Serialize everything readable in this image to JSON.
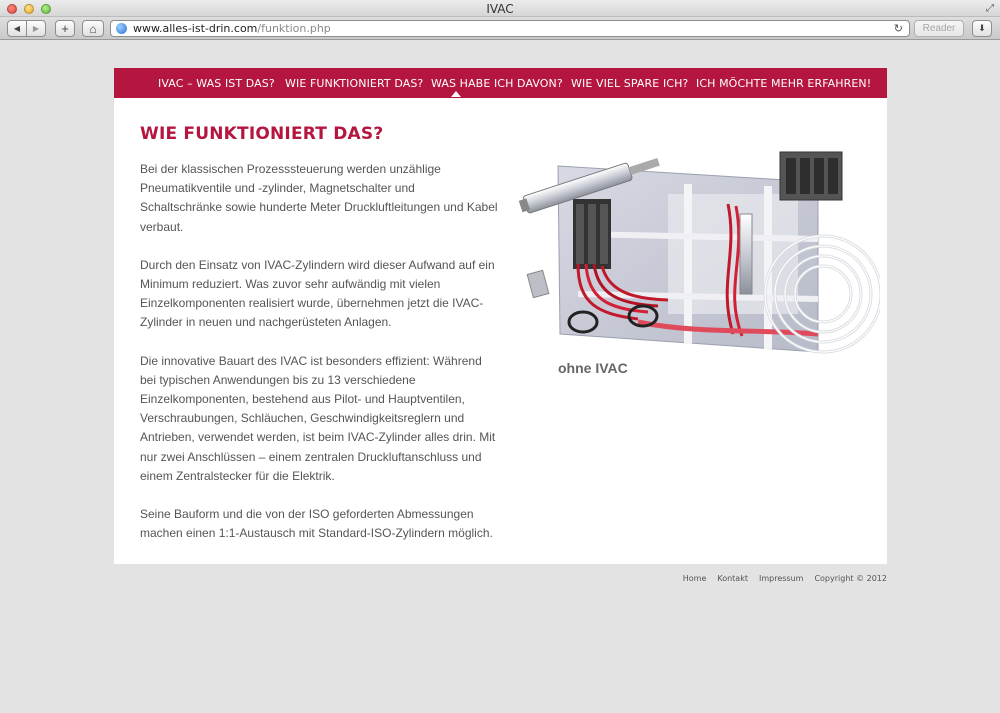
{
  "window": {
    "title": "IVAC"
  },
  "toolbar": {
    "back_icon": "◀",
    "forward_icon": "▶",
    "add_icon": "+",
    "home_icon": "⌂",
    "url_host": "www.alles-ist-drin.com",
    "url_path": "/funktion.php",
    "reload_icon": "↻",
    "reader_label": "Reader",
    "downloads_icon": "⬇"
  },
  "nav": {
    "items": [
      {
        "label": "IVAC – WAS IST DAS?"
      },
      {
        "label": "WIE FUNKTIONIERT DAS?"
      },
      {
        "label": "WAS HABE ICH DAVON?"
      },
      {
        "label": "WIE VIEL SPARE ICH?"
      },
      {
        "label": "ICH MÖCHTE MEHR ERFAHREN!"
      }
    ],
    "active_index": 1,
    "color": "#b5163f"
  },
  "main": {
    "title": "WIE FUNKTIONIERT DAS?",
    "paragraphs": [
      "Bei der klassischen Prozesssteuerung werden unzählige Pneumatikventile und -zylinder, Magnetschalter und Schaltschränke sowie hunderte Meter Druckluftleitungen und Kabel verbaut.",
      "Durch den Einsatz von IVAC-Zylindern wird dieser Aufwand auf ein Minimum reduziert. Was zuvor sehr aufwändig mit vielen Einzelkomponenten realisiert wurde, übernehmen jetzt die IVAC-Zylinder in neuen und nachgerüsteten Anlagen.",
      "Die innovative Bauart des IVAC ist besonders effizient: Während bei typischen Anwendungen bis zu 13 verschiedene Einzelkomponenten, bestehend aus Pilot- und Hauptventilen, Verschraubungen, Schläuchen, Geschwindigkeitsreglern und Antrieben, verwendet werden, ist beim IVAC-Zylinder alles drin. Mit nur zwei Anschlüssen – einem zentralen Druckluftanschluss und einem Zentralstecker für die Elektrik.",
      "Seine Bauform und die von der ISO geforderten Abmessungen machen einen 1:1-Austausch mit Standard-ISO-Zylindern möglich."
    ],
    "figure_caption": "ohne IVAC"
  },
  "footer": {
    "home": "Home",
    "contact": "Kontakt",
    "imprint": "Impressum",
    "copyright": "Copyright © 2012"
  }
}
